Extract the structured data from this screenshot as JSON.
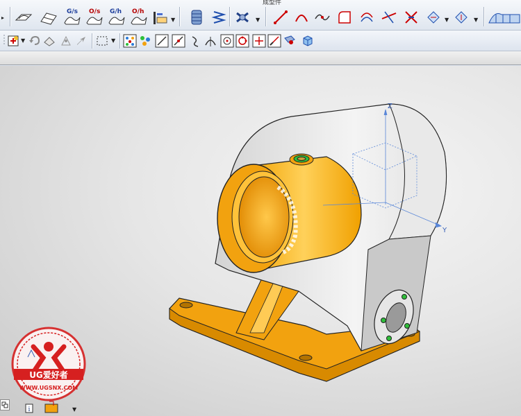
{
  "toolbar_top": {
    "title_fragment": "成型件",
    "group_labels": [
      "G/s",
      "O/s",
      "G/h",
      "O/h"
    ],
    "icons": [
      "curve-tool-icon",
      "surface-tool-icon",
      "spring-icon",
      "cut-icon",
      "line-icon",
      "arc-icon",
      "spline-icon",
      "fillet-icon",
      "offset-icon",
      "trim-icon",
      "extend-icon",
      "view-icon",
      "surface-strip-icon"
    ]
  },
  "toolbar_second": {
    "icons": [
      "snap-add-icon",
      "undo-icon",
      "eraser-icon",
      "transform-icon",
      "select-box-icon",
      "points-icon",
      "cluster-icon",
      "line-snap-icon",
      "midpoint-icon",
      "curve-snap-icon",
      "intersection-icon",
      "center-icon",
      "quadrant-icon",
      "cross-icon",
      "slash-icon",
      "face-snap-icon",
      "cube-icon"
    ]
  },
  "viewport": {
    "axis_labels": {
      "z": "Z",
      "y": "Y"
    },
    "colors": {
      "orange": "#f2a20f",
      "orange_dark": "#c97c00",
      "gray_body": "#d9d9d9",
      "green_hole": "#2fbf3a"
    }
  },
  "watermark": {
    "brand": "UG爱好者",
    "url": "WWW.UGSNX.COM"
  }
}
